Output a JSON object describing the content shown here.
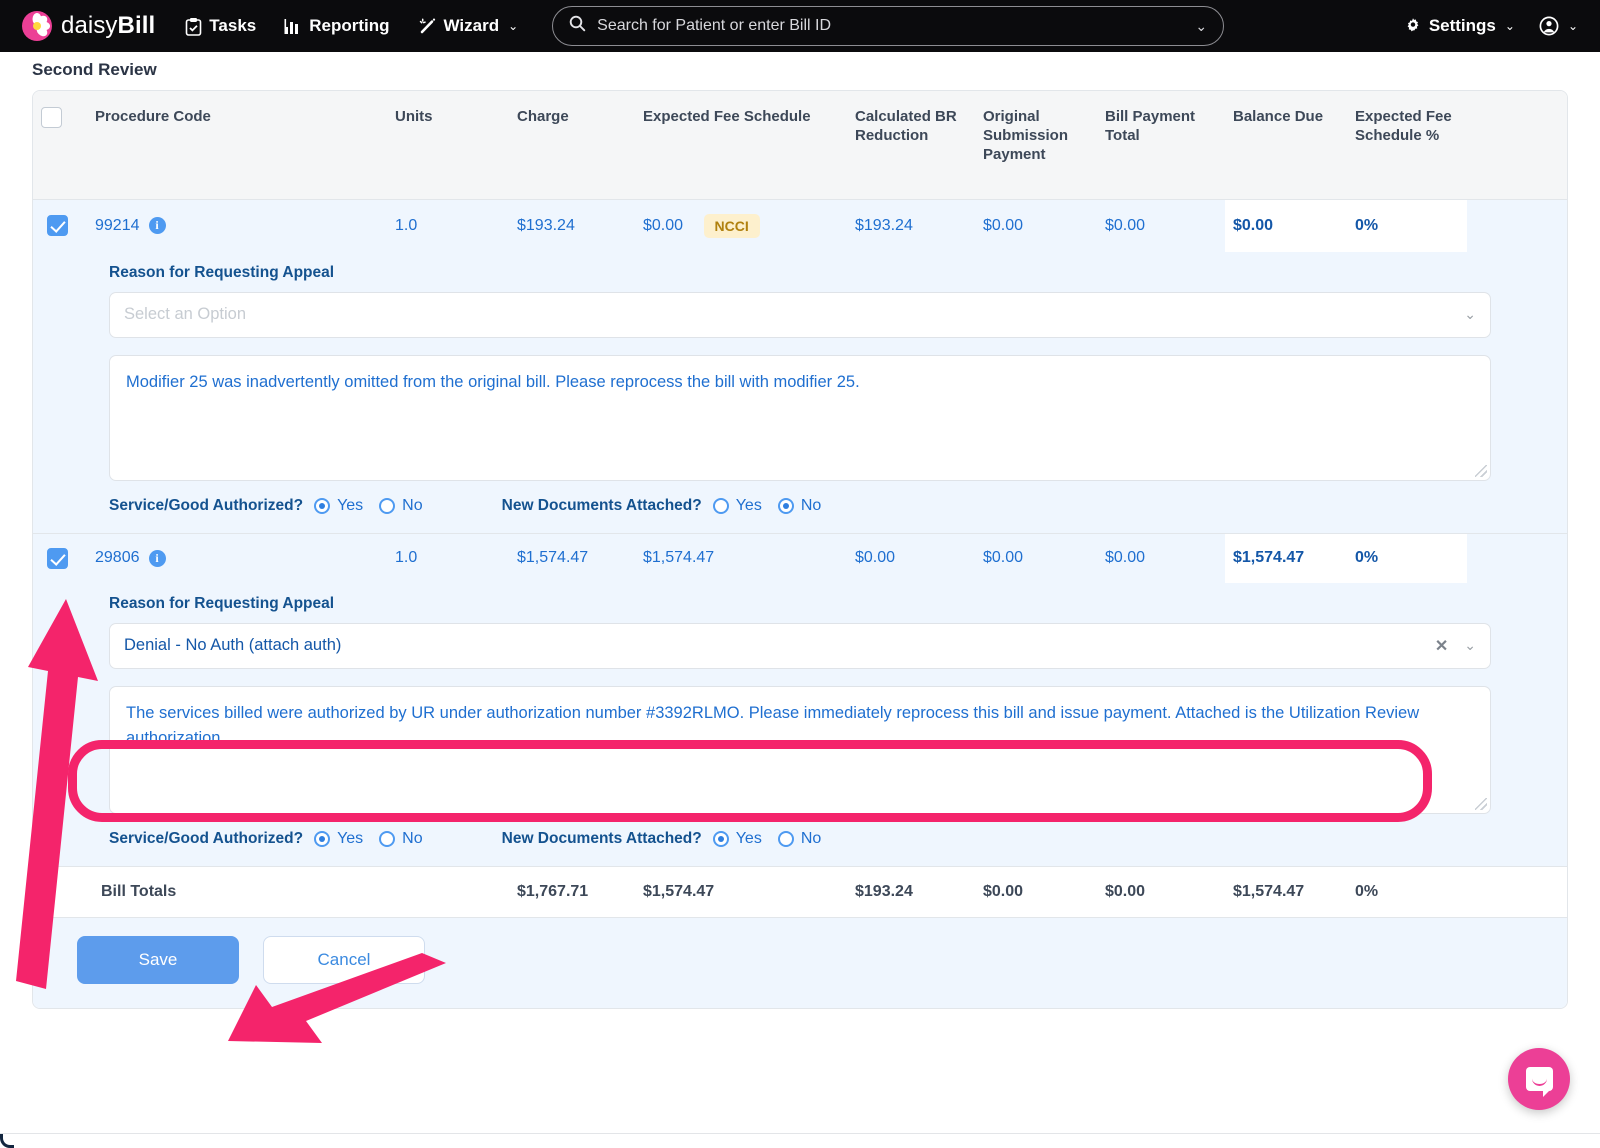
{
  "navbar": {
    "brand_first": "daisy",
    "brand_second": "Bill",
    "items": [
      {
        "label": "Tasks",
        "icon": "clipboard-check-icon"
      },
      {
        "label": "Reporting",
        "icon": "bar-chart-icon"
      },
      {
        "label": "Wizard",
        "icon": "magic-wand-icon",
        "caret": "⌄"
      }
    ],
    "search": {
      "placeholder": "Search for Patient or enter Bill ID",
      "value": "",
      "icon": "search-icon",
      "caret": "⌄"
    },
    "settings": {
      "label": "Settings",
      "icon": "gear-icon",
      "caret": "⌄"
    },
    "account": {
      "icon": "user-circle-icon",
      "caret": "⌄"
    }
  },
  "page": {
    "section_title": "Second Review"
  },
  "table": {
    "headers": [
      "",
      "Procedure Code",
      "Units",
      "Charge",
      "Expected Fee Schedule",
      "Calculated BR Reduction",
      "Original Submission Payment",
      "Bill Payment Total",
      "Balance Due",
      "Expected Fee Schedule %"
    ],
    "header_select_all_checked": false,
    "rows": [
      {
        "checked": true,
        "procedure_code": "99214",
        "units": "1.0",
        "charge": "$193.24",
        "expected_fee_schedule": "$0.00",
        "badge": "NCCI",
        "calculated_br_reduction": "$193.24",
        "original_submission_payment": "$0.00",
        "bill_payment_total": "$0.00",
        "balance_due": "$0.00",
        "expected_fee_schedule_pct": "0%",
        "appeal": {
          "label": "Reason for Requesting Appeal",
          "select_placeholder": "Select an Option",
          "select_value": "",
          "note": "Modifier 25 was inadvertently omitted from the original bill. Please reprocess the bill with modifier 25.",
          "authorized_label": "Service/Good Authorized?",
          "authorized_yes": "Yes",
          "authorized_no": "No",
          "authorized_value": "Yes",
          "docs_label": "New Documents Attached?",
          "docs_yes": "Yes",
          "docs_no": "No",
          "docs_value": "No"
        }
      },
      {
        "checked": true,
        "procedure_code": "29806",
        "units": "1.0",
        "charge": "$1,574.47",
        "expected_fee_schedule": "$1,574.47",
        "badge": "",
        "calculated_br_reduction": "$0.00",
        "original_submission_payment": "$0.00",
        "bill_payment_total": "$0.00",
        "balance_due": "$1,574.47",
        "expected_fee_schedule_pct": "0%",
        "appeal": {
          "label": "Reason for Requesting Appeal",
          "select_placeholder": "Select an Option",
          "select_value": "Denial - No Auth (attach auth)",
          "select_clear": "✕",
          "note": "The services billed were authorized by UR under authorization number #3392RLMO. Please immediately reprocess this bill and issue payment. Attached is the Utilization Review authorization.",
          "authorized_label": "Service/Good Authorized?",
          "authorized_yes": "Yes",
          "authorized_no": "No",
          "authorized_value": "Yes",
          "docs_label": "New Documents Attached?",
          "docs_yes": "Yes",
          "docs_no": "No",
          "docs_value": "Yes"
        }
      }
    ],
    "totals": {
      "label": "Bill Totals",
      "units": "",
      "charge": "$1,767.71",
      "expected_fee_schedule": "$1,574.47",
      "calculated_br_reduction": "$193.24",
      "original_submission_payment": "$0.00",
      "bill_payment_total": "$0.00",
      "balance_due": "$1,574.47",
      "expected_fee_schedule_pct": "0%"
    }
  },
  "actions": {
    "save_label": "Save",
    "cancel_label": "Cancel"
  },
  "chat": {
    "icon": "chat-bubble-icon"
  },
  "colors": {
    "brand_pink": "#ec3f96",
    "annotation_pink": "#f4246b",
    "accent_blue": "#4e9af1",
    "link_blue": "#1f6fd0",
    "row_blue": "#eff6fe",
    "badge_bg": "#fdf0cd",
    "badge_text": "#b0810f",
    "navbar_bg": "#0b0b0d"
  }
}
